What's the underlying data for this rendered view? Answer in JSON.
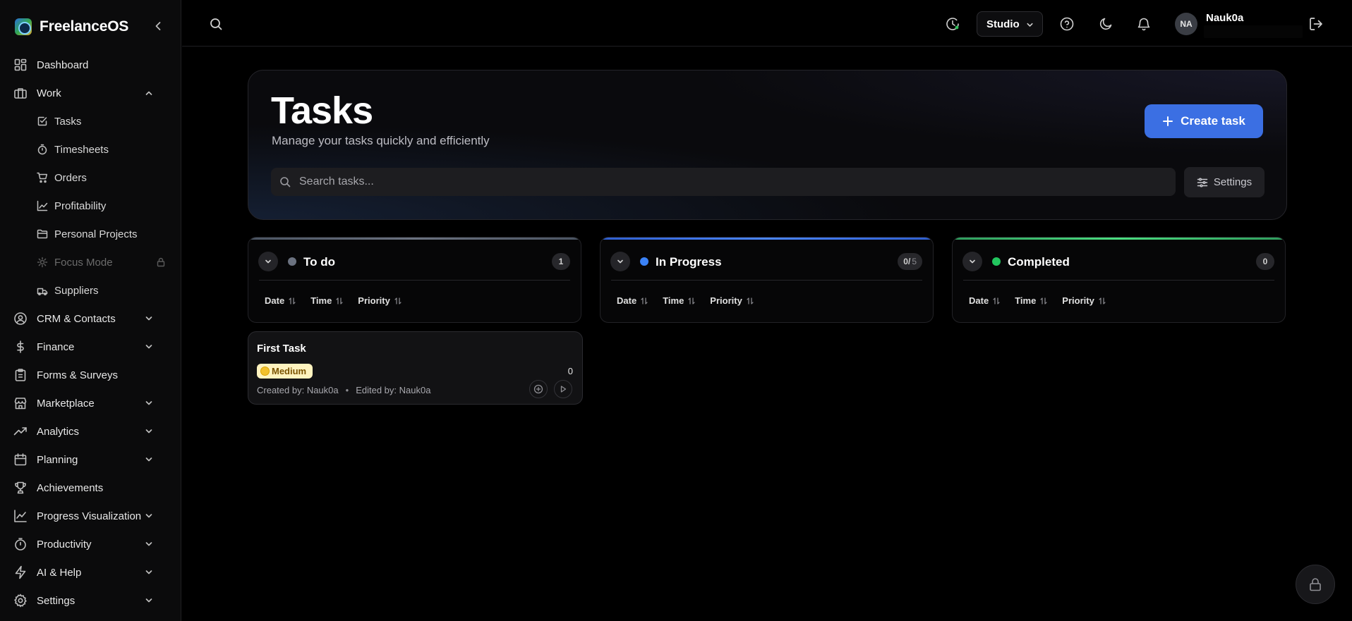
{
  "app": {
    "name": "FreelanceOS"
  },
  "sidebar": {
    "items": [
      {
        "label": "Dashboard",
        "icon": "dashboard-icon"
      },
      {
        "label": "Work",
        "icon": "briefcase-icon",
        "expanded": true
      },
      {
        "label": "CRM & Contacts",
        "icon": "contacts-icon"
      },
      {
        "label": "Finance",
        "icon": "dollar-icon"
      },
      {
        "label": "Forms & Surveys",
        "icon": "clipboard-icon"
      },
      {
        "label": "Marketplace",
        "icon": "store-icon"
      },
      {
        "label": "Analytics",
        "icon": "trend-icon"
      },
      {
        "label": "Planning",
        "icon": "calendar-icon"
      },
      {
        "label": "Achievements",
        "icon": "trophy-icon"
      },
      {
        "label": "Progress Visualization",
        "icon": "line-chart-icon"
      },
      {
        "label": "Productivity",
        "icon": "timer-icon"
      },
      {
        "label": "AI & Help",
        "icon": "bolt-icon"
      },
      {
        "label": "Settings",
        "icon": "gear-icon"
      }
    ],
    "work_items": [
      {
        "label": "Tasks",
        "icon": "check-square-icon"
      },
      {
        "label": "Timesheets",
        "icon": "stopwatch-icon"
      },
      {
        "label": "Orders",
        "icon": "cart-icon"
      },
      {
        "label": "Profitability",
        "icon": "chart-icon"
      },
      {
        "label": "Personal Projects",
        "icon": "folder-icon"
      },
      {
        "label": "Focus Mode",
        "icon": "focus-icon",
        "locked": true
      },
      {
        "label": "Suppliers",
        "icon": "supplier-icon"
      }
    ]
  },
  "topbar": {
    "workspace": "Studio",
    "user": {
      "initials": "NA",
      "name": "Nauk0a"
    }
  },
  "page": {
    "title": "Tasks",
    "subtitle": "Manage your tasks quickly and efficiently",
    "create_label": "Create task",
    "search_placeholder": "Search tasks...",
    "settings_label": "Settings"
  },
  "columns": [
    {
      "title": "To do",
      "count": "1",
      "max": "",
      "dot_color": "#6b7280"
    },
    {
      "title": "In Progress",
      "count": "0/",
      "max": "5",
      "dot_color": "#3b82f6"
    },
    {
      "title": "Completed",
      "count": "0",
      "max": "",
      "dot_color": "#22c55e"
    }
  ],
  "sort_labels": {
    "date": "Date",
    "time": "Time",
    "priority": "Priority"
  },
  "task": {
    "title": "First Task",
    "priority": "Medium",
    "count": "0",
    "created": "Created by: Nauk0a",
    "separator": "•",
    "edited": "Edited by: Nauk0a"
  }
}
